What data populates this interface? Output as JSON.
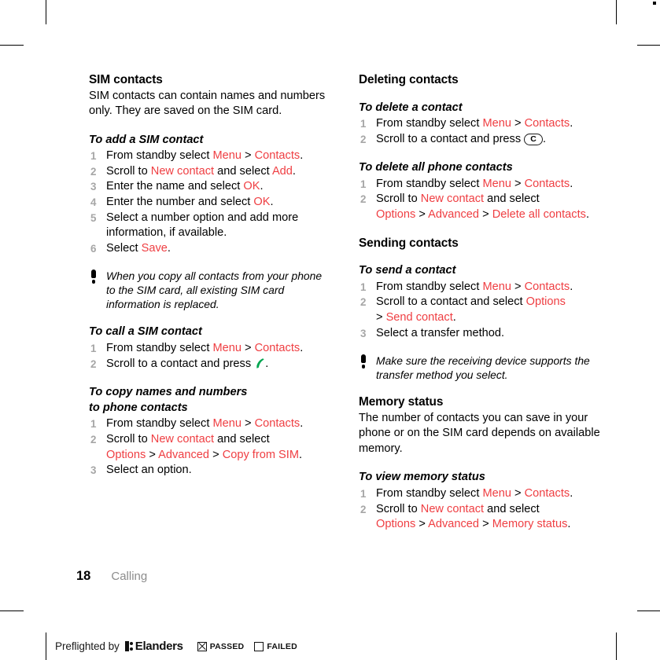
{
  "page": {
    "folio": "18",
    "chapter": "Calling",
    "red_accent": "#ef3e42",
    "gray_number": "#a6a6a6",
    "gray_chapter": "#8c8c8c"
  },
  "left_column": {
    "section_heading": "SIM contacts",
    "intro": "SIM contacts can contain names and numbers only. They are saved on the SIM card.",
    "proc_add": {
      "title": "To add a SIM contact",
      "steps": [
        {
          "parts": [
            {
              "t": "From standby select ",
              "c": "black"
            },
            {
              "t": "Menu",
              "c": "red"
            },
            {
              "t": " > ",
              "c": "black"
            },
            {
              "t": "Contacts",
              "c": "red"
            },
            {
              "t": ".",
              "c": "black"
            }
          ]
        },
        {
          "parts": [
            {
              "t": "Scroll to ",
              "c": "black"
            },
            {
              "t": "New contact",
              "c": "red"
            },
            {
              "t": " and select ",
              "c": "black"
            },
            {
              "t": "Add",
              "c": "red"
            },
            {
              "t": ".",
              "c": "black"
            }
          ]
        },
        {
          "parts": [
            {
              "t": "Enter the name and select ",
              "c": "black"
            },
            {
              "t": "OK",
              "c": "red"
            },
            {
              "t": ".",
              "c": "black"
            }
          ]
        },
        {
          "parts": [
            {
              "t": "Enter the number and select ",
              "c": "black"
            },
            {
              "t": "OK",
              "c": "red"
            },
            {
              "t": ".",
              "c": "black"
            }
          ]
        },
        {
          "parts": [
            {
              "t": "Select a number option and add more information, if available.",
              "c": "black"
            }
          ]
        },
        {
          "parts": [
            {
              "t": "Select ",
              "c": "black"
            },
            {
              "t": "Save",
              "c": "red"
            },
            {
              "t": ".",
              "c": "black"
            }
          ]
        }
      ]
    },
    "note": "When you copy all contacts from your phone to the SIM card, all existing SIM card information is replaced.",
    "proc_call": {
      "title": "To call a SIM contact",
      "steps": [
        {
          "parts": [
            {
              "t": "From standby select ",
              "c": "black"
            },
            {
              "t": "Menu",
              "c": "red"
            },
            {
              "t": " > ",
              "c": "black"
            },
            {
              "t": "Contacts",
              "c": "red"
            },
            {
              "t": ".",
              "c": "black"
            }
          ]
        },
        {
          "parts": [
            {
              "t": "Scroll to a contact and press ",
              "c": "black"
            },
            {
              "t": "",
              "c": "icon-call"
            },
            {
              "t": ".",
              "c": "black"
            }
          ]
        }
      ]
    },
    "proc_copy": {
      "title_line1": "To copy names and numbers",
      "title_line2": "to phone contacts",
      "steps": [
        {
          "parts": [
            {
              "t": "From standby select ",
              "c": "black"
            },
            {
              "t": "Menu",
              "c": "red"
            },
            {
              "t": " > ",
              "c": "black"
            },
            {
              "t": "Contacts",
              "c": "red"
            },
            {
              "t": ".",
              "c": "black"
            }
          ]
        },
        {
          "parts": [
            {
              "t": "Scroll to ",
              "c": "black"
            },
            {
              "t": "New contact",
              "c": "red"
            },
            {
              "t": " and select ",
              "c": "black"
            },
            {
              "t": "\n",
              "c": "break"
            },
            {
              "t": "Options",
              "c": "red"
            },
            {
              "t": " > ",
              "c": "black"
            },
            {
              "t": "Advanced",
              "c": "red"
            },
            {
              "t": " > ",
              "c": "black"
            },
            {
              "t": "Copy from SIM",
              "c": "red"
            },
            {
              "t": ".",
              "c": "black"
            }
          ]
        },
        {
          "parts": [
            {
              "t": "Select an option.",
              "c": "black"
            }
          ]
        }
      ]
    }
  },
  "right_column": {
    "section_heading_deleting": "Deleting contacts",
    "proc_delete_one": {
      "title": "To delete a contact",
      "steps": [
        {
          "parts": [
            {
              "t": "From standby select ",
              "c": "black"
            },
            {
              "t": "Menu",
              "c": "red"
            },
            {
              "t": " > ",
              "c": "black"
            },
            {
              "t": "Contacts",
              "c": "red"
            },
            {
              "t": ".",
              "c": "black"
            }
          ]
        },
        {
          "parts": [
            {
              "t": "Scroll to a contact and press ",
              "c": "black"
            },
            {
              "t": "C",
              "c": "key"
            },
            {
              "t": ".",
              "c": "black"
            }
          ]
        }
      ]
    },
    "proc_delete_all": {
      "title": "To delete all phone contacts",
      "steps": [
        {
          "parts": [
            {
              "t": "From standby select ",
              "c": "black"
            },
            {
              "t": "Menu",
              "c": "red"
            },
            {
              "t": " > ",
              "c": "black"
            },
            {
              "t": "Contacts",
              "c": "red"
            },
            {
              "t": ".",
              "c": "black"
            }
          ]
        },
        {
          "parts": [
            {
              "t": "Scroll to ",
              "c": "black"
            },
            {
              "t": "New contact",
              "c": "red"
            },
            {
              "t": " and select ",
              "c": "black"
            },
            {
              "t": "\n",
              "c": "break"
            },
            {
              "t": "Options",
              "c": "red"
            },
            {
              "t": " > ",
              "c": "black"
            },
            {
              "t": "Advanced",
              "c": "red"
            },
            {
              "t": " > ",
              "c": "black"
            },
            {
              "t": "Delete all contacts",
              "c": "red"
            },
            {
              "t": ".",
              "c": "black"
            }
          ]
        }
      ]
    },
    "section_heading_sending": "Sending contacts",
    "proc_send": {
      "title": "To send a contact",
      "steps": [
        {
          "parts": [
            {
              "t": "From standby select ",
              "c": "black"
            },
            {
              "t": "Menu",
              "c": "red"
            },
            {
              "t": " > ",
              "c": "black"
            },
            {
              "t": "Contacts",
              "c": "red"
            },
            {
              "t": ".",
              "c": "black"
            }
          ]
        },
        {
          "parts": [
            {
              "t": "Scroll to a contact and select ",
              "c": "black"
            },
            {
              "t": "Options",
              "c": "red"
            },
            {
              "t": "\n",
              "c": "break"
            },
            {
              "t": "> ",
              "c": "black"
            },
            {
              "t": "Send contact",
              "c": "red"
            },
            {
              "t": ".",
              "c": "black"
            }
          ]
        },
        {
          "parts": [
            {
              "t": "Select a transfer method.",
              "c": "black"
            }
          ]
        }
      ]
    },
    "note": "Make sure the receiving device supports the transfer method you select.",
    "section_heading_memory": "Memory status",
    "memory_intro": "The number of contacts you can save in your phone or on the SIM card depends on available memory.",
    "proc_memory": {
      "title": "To view memory status",
      "steps": [
        {
          "parts": [
            {
              "t": "From standby select ",
              "c": "black"
            },
            {
              "t": "Menu",
              "c": "red"
            },
            {
              "t": " > ",
              "c": "black"
            },
            {
              "t": "Contacts",
              "c": "red"
            },
            {
              "t": ".",
              "c": "black"
            }
          ]
        },
        {
          "parts": [
            {
              "t": "Scroll to ",
              "c": "black"
            },
            {
              "t": "New contact",
              "c": "red"
            },
            {
              "t": " and select ",
              "c": "black"
            },
            {
              "t": "\n",
              "c": "break"
            },
            {
              "t": "Options",
              "c": "red"
            },
            {
              "t": " > ",
              "c": "black"
            },
            {
              "t": "Advanced",
              "c": "red"
            },
            {
              "t": " > ",
              "c": "black"
            },
            {
              "t": "Memory status",
              "c": "red"
            },
            {
              "t": ".",
              "c": "black"
            }
          ]
        }
      ]
    }
  },
  "preflight": {
    "label": "Preflighted by",
    "brand": "Elanders",
    "passed_label": "PASSED",
    "failed_label": "FAILED",
    "passed_checked": true,
    "failed_checked": false
  }
}
